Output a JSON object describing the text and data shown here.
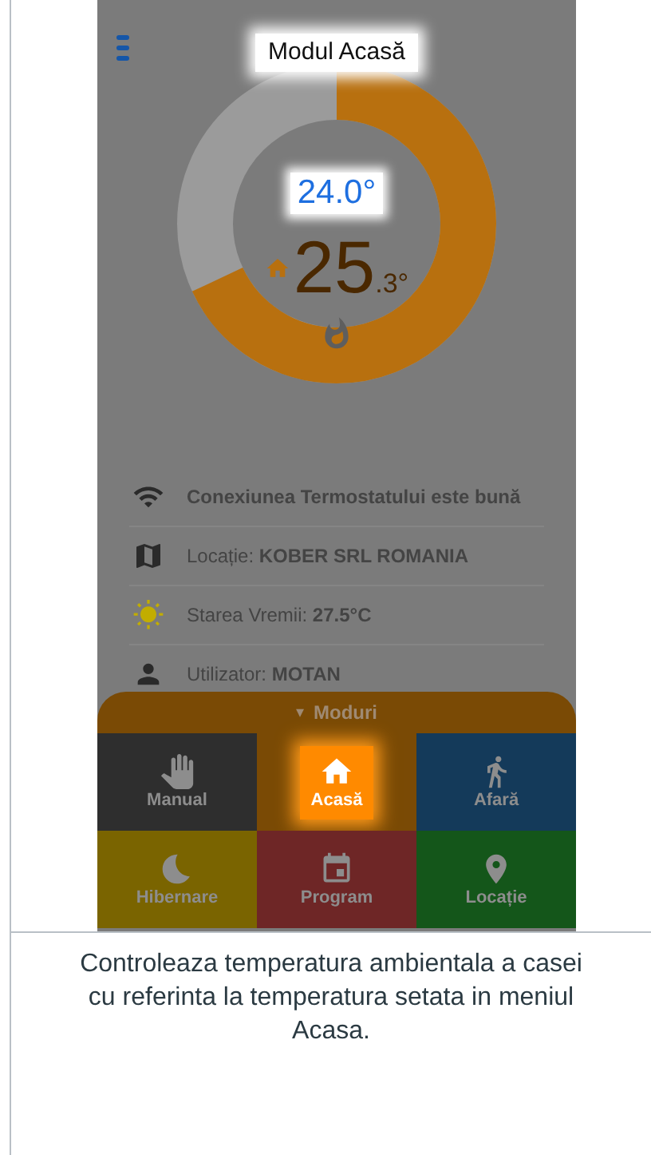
{
  "header": {
    "title": "Modul Acasă"
  },
  "thermostat": {
    "setpoint": "24.0°",
    "temperature": "25",
    "temperature_decimal": ".3°"
  },
  "info_rows": [
    {
      "text": "**Conexiunea Termostatului este bună**"
    },
    {
      "text": "Locație: **KOBER SRL ROMANIA**"
    },
    {
      "text": "Starea Vremii: **27.5°C**"
    },
    {
      "text": "Utilizator: **MOTAN**"
    }
  ],
  "modes_panel": {
    "toggle": "▾",
    "title": "Moduri"
  },
  "modes": [
    {
      "label": "Manual",
      "selected": false,
      "color": "#2e2e2e"
    },
    {
      "label": "Acasă",
      "selected": true,
      "color": "#7a4a05"
    },
    {
      "label": "Afară",
      "selected": false,
      "color": "#143a5a"
    },
    {
      "label": "Hibernare",
      "selected": false,
      "color": "#7a6400"
    },
    {
      "label": "Program",
      "selected": false,
      "color": "#6e2626"
    },
    {
      "label": "Locație",
      "selected": false,
      "color": "#14561a"
    }
  ],
  "caption": "Controleaza temperatura ambientala a casei cu referinta la temperatura setata in meniul Acasa."
}
